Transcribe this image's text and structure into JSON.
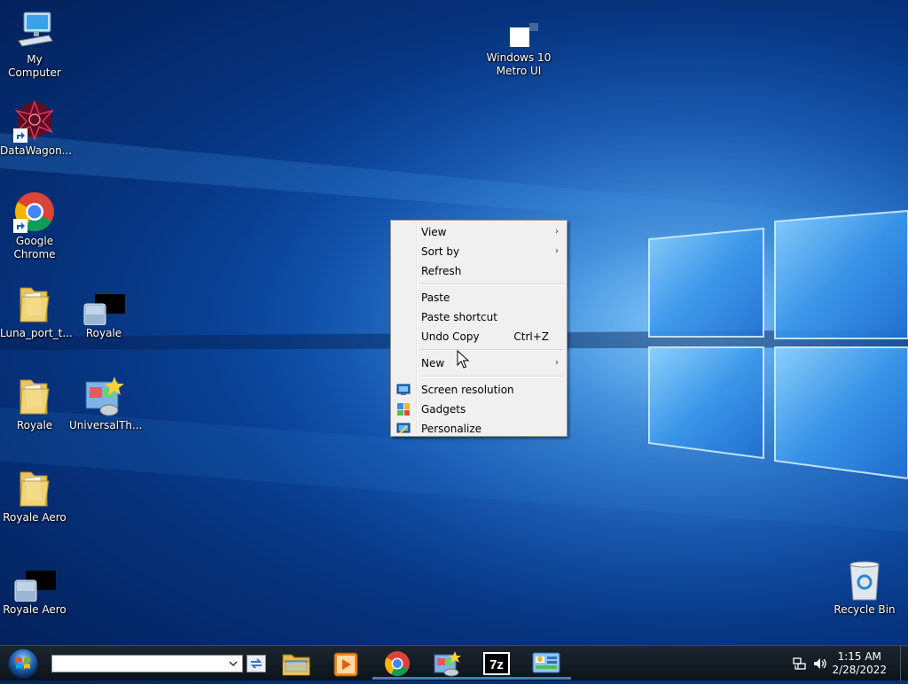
{
  "desktop": {
    "icons": [
      {
        "label": "My Computer"
      },
      {
        "label": "DataWagon..."
      },
      {
        "label": "Google\nChrome"
      },
      {
        "label": "Luna_port_t..."
      },
      {
        "label": "Royale"
      },
      {
        "label": "Royale"
      },
      {
        "label": "UniversalTh..."
      },
      {
        "label": "Royale Aero"
      },
      {
        "label": "Royale Aero"
      },
      {
        "label": "Windows 10\nMetro UI"
      },
      {
        "label": "Recycle Bin"
      }
    ]
  },
  "context_menu": {
    "view": "View",
    "sort_by": "Sort by",
    "refresh": "Refresh",
    "paste": "Paste",
    "paste_shortcut": "Paste shortcut",
    "undo_copy": "Undo Copy",
    "undo_copy_shortcut": "Ctrl+Z",
    "new": "New",
    "screen_resolution": "Screen resolution",
    "gadgets": "Gadgets",
    "personalize": "Personalize",
    "submenu_arrow": "›"
  },
  "taskbar": {
    "search_value": "",
    "clock_time": "1:15 AM",
    "clock_date": "2/28/2022",
    "sevenzip_label": "7z"
  },
  "colors": {
    "accent": "#0c4aa2",
    "menu_bg": "#f0f0f0",
    "taskbar": "#141d25"
  }
}
